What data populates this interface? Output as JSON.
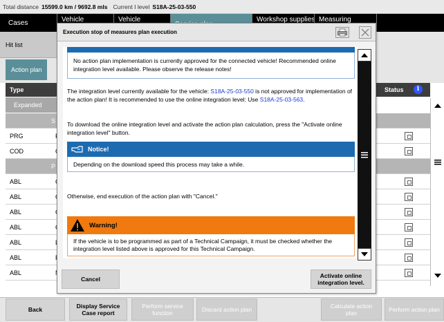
{
  "infobar": {
    "distance_label": "Total distance",
    "distance_value": "15599.0 km / 9692.8 mls",
    "level_label": "Current I level",
    "level_value": "S18A-25-03-550"
  },
  "tabs": [
    {
      "label": "Cases"
    },
    {
      "label": "Vehicle"
    },
    {
      "label": "Vehicle"
    },
    {
      "label": "Service plan"
    },
    {
      "label": "Workshop supplies/"
    },
    {
      "label": "Measuring"
    }
  ],
  "hitlist": {
    "label": "Hit list"
  },
  "action_plan": {
    "tab_label": "Action plan"
  },
  "table": {
    "col_type": "Type",
    "col_status": "Status",
    "info_glyph": "i",
    "expanded_label": "Expanded",
    "section_s": "S",
    "section_p": "P",
    "rows": [
      {
        "type": "PRG",
        "ch": "F"
      },
      {
        "type": "COD",
        "ch": "C"
      },
      {
        "type": "ABL",
        "ch": "C"
      },
      {
        "type": "ABL",
        "ch": "C"
      },
      {
        "type": "ABL",
        "ch": "C"
      },
      {
        "type": "ABL",
        "ch": "C"
      },
      {
        "type": "ABL",
        "ch": "L"
      },
      {
        "type": "ABL",
        "ch": "F"
      },
      {
        "type": "ABL",
        "ch": "N"
      }
    ]
  },
  "modal": {
    "title": "Execution stop of measures plan execution",
    "box1_text": "No action plan implementation is currently approved for the connected vehicle! Recommended online integration level available. Please observe the release notes!",
    "para1_pre": "The integration level currently available for the vehicle: ",
    "para1_link1": "S18A-25-03-550",
    "para1_mid": " is not approved for implementation of the action plan! It is recommended to use the online integration level:  Use ",
    "para1_link2": "S18A-25-03-563",
    "para1_post": ".",
    "para2": "To download the online integration level and activate the action plan calculation, press the \"Activate online integration level\" button.",
    "notice_title": "Notice!",
    "notice_text": "Depending on the download speed this process may take a while.",
    "para3": "Otherwise, end execution of the action plan with \"Cancel.\"",
    "warning_title": "Warning!",
    "warning_text": "If the vehicle is to be programmed as part of a Technical Campaign, it must be checked whether the integration level listed above is approved for this Technical Campaign.",
    "cancel_label": "Cancel",
    "activate_label": "Activate online integration level."
  },
  "bottom": {
    "back": "Back",
    "display_report": "Display Service Case report",
    "perform_function": "Perform service function",
    "discard_plan": "Discard action plan",
    "calculate_plan": "Calculate action plan",
    "perform_plan": "Perform action plan"
  },
  "colors": {
    "accent_teal": "#5a8f99",
    "notice_blue": "#1c6bb1",
    "warning_orange": "#f07a0f",
    "link_blue": "#1a3bd1"
  }
}
